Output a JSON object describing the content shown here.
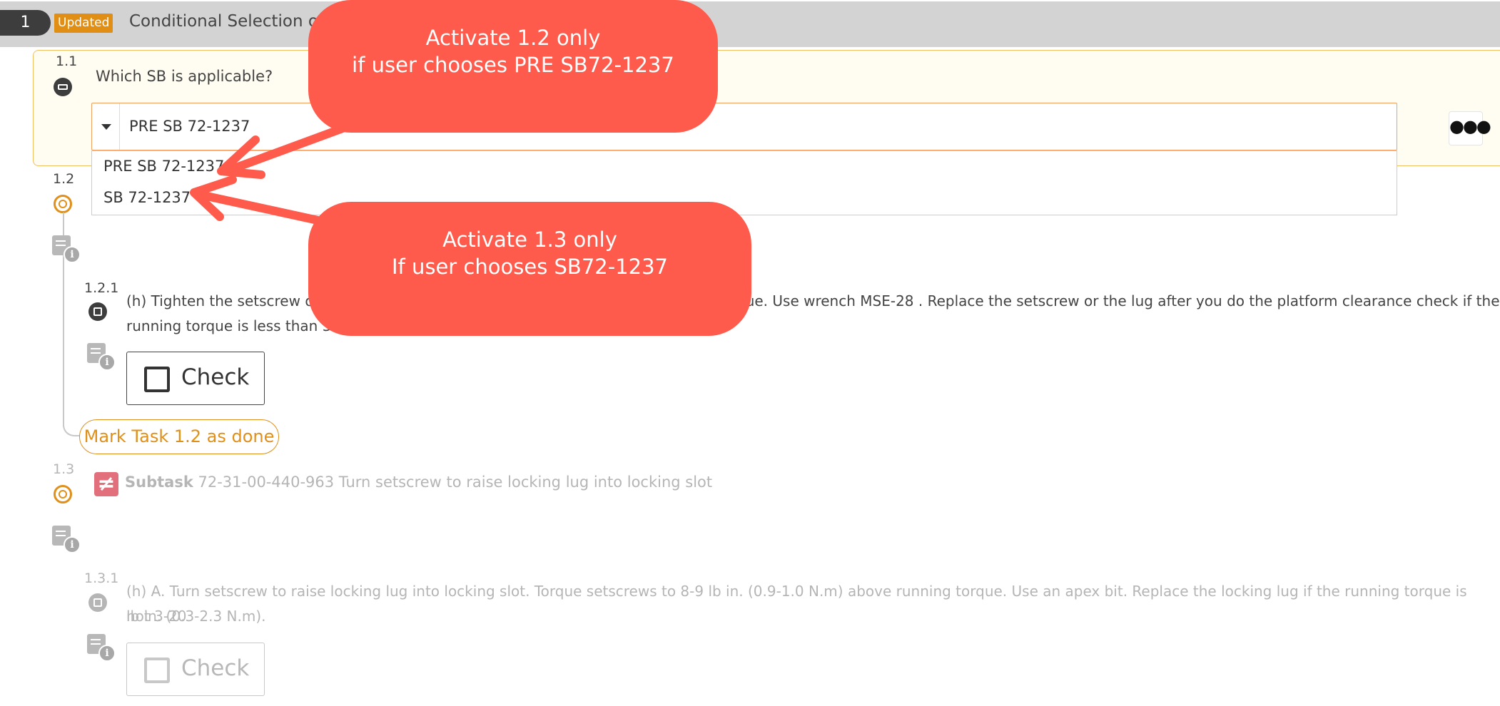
{
  "header": {
    "step_number": "1",
    "badge": "Updated",
    "title": "Conditional Selection of"
  },
  "task_1_1": {
    "number": "1.1",
    "question": "Which SB is applicable?",
    "selected_value": "PRE SB 72-1237",
    "more_label": "●●●",
    "options": [
      "PRE SB 72-1237",
      "SB 72-1237"
    ]
  },
  "task_1_2": {
    "number": "1.2",
    "step_number": "1.2.1",
    "step_text": "(h) Tighten the setscrew of",
    "step_text_right": "que. Use wrench MSE-28 . Replace the setscrew or the lug after you do the platform clearance check if the",
    "step_text_line2": "running torque is less than 3 i",
    "check_label": "Check",
    "mark_done_label": "Mark Task 1.2 as done"
  },
  "task_1_3": {
    "number": "1.3",
    "subtask_prefix": "Subtask",
    "subtask_text": "72-31-00-440-963 Turn setscrew to raise locking lug into locking slot",
    "step_number": "1.3.1",
    "step_text_line1": "(h) A. Turn setscrew to raise locking lug into locking slot. Torque setscrews to 8-9 lb in. (0.9-1.0 N.m) above running torque. Use an apex bit. Replace the locking lug if the running torque is not 3-20",
    "step_text_line2": "lb in. (0.3-2.3 N.m).",
    "check_label": "Check"
  },
  "annotations": {
    "callout_top": [
      "Activate 1.2 only",
      "if user chooses PRE SB72-1237"
    ],
    "callout_bottom": [
      "Activate 1.3 only",
      "If user chooses SB72-1237"
    ]
  },
  "colors": {
    "accent_orange": "#e0901a",
    "callout_red": "#fe5b4c",
    "header_gray": "#d3d3d3",
    "panel_bg": "#fffcf1"
  }
}
